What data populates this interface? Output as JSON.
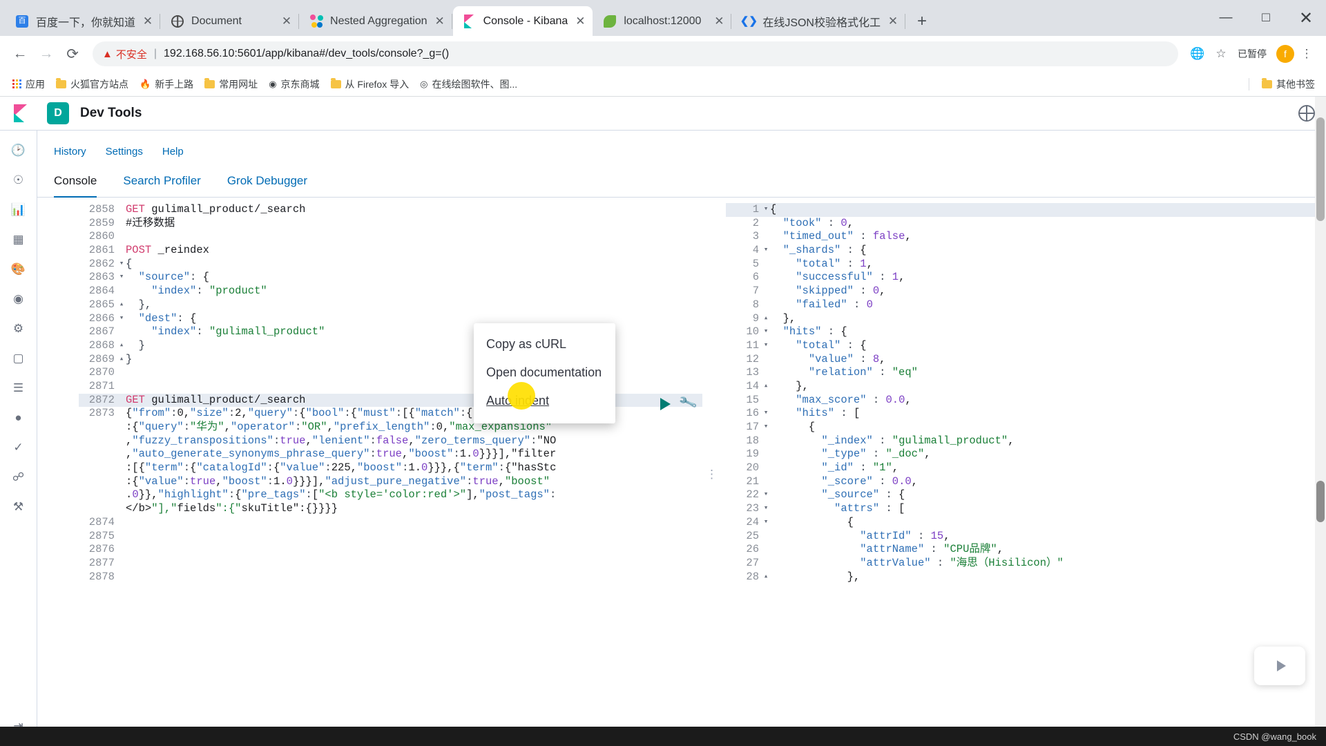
{
  "browser": {
    "tabs": [
      {
        "title": "百度一下，你就知道",
        "favicon": "baidu-icon",
        "active": false
      },
      {
        "title": "Document",
        "favicon": "globe-icon",
        "active": false
      },
      {
        "title": "Nested Aggregation",
        "favicon": "elasticsearch-icon",
        "active": false
      },
      {
        "title": "Console - Kibana",
        "favicon": "kibana-icon",
        "active": true
      },
      {
        "title": "localhost:12000",
        "favicon": "spring-leaf-icon",
        "active": false
      },
      {
        "title": "在线JSON校验格式化工",
        "favicon": "code-brackets-icon",
        "active": false
      }
    ],
    "new_tab_label": "+",
    "window_controls": {
      "minimize": "—",
      "maximize": "□",
      "close": "✕"
    },
    "nav": {
      "back": "←",
      "forward": "→",
      "reload": "⟳"
    },
    "omnibox": {
      "warning_icon": "warning-triangle-icon",
      "security_label": "不安全",
      "url_host": "192.168.56.10",
      "url_path": ":5601/app/kibana#/dev_tools/console?_g=()"
    },
    "toolbar_icons": {
      "translate": "translate-icon",
      "bookmark_star": "star-icon",
      "paused_label": "已暂停",
      "profile_initial": "f",
      "menu": "⋮"
    },
    "bookmarks": [
      {
        "label": "应用",
        "icon": "apps-grid-icon"
      },
      {
        "label": "火狐官方站点",
        "icon": "folder-icon"
      },
      {
        "label": "新手上路",
        "icon": "firefox-icon"
      },
      {
        "label": "常用网址",
        "icon": "folder-icon"
      },
      {
        "label": "京东商城",
        "icon": "jd-icon"
      },
      {
        "label": "从 Firefox 导入",
        "icon": "folder-icon"
      },
      {
        "label": "在线绘图软件、图...",
        "icon": "diagram-icon"
      }
    ],
    "bookmarks_right": {
      "label": "其他书签",
      "icon": "folder-icon"
    }
  },
  "kibana": {
    "app_title": "Dev Tools",
    "space_initial": "D",
    "logo": "kibana-logo-icon",
    "help_icon": "help-globe-icon",
    "topnav": [
      "History",
      "Settings",
      "Help"
    ],
    "tabs": [
      {
        "label": "Console",
        "active": true
      },
      {
        "label": "Search Profiler",
        "active": false
      },
      {
        "label": "Grok Debugger",
        "active": false
      }
    ],
    "sidebar_icons": [
      "recently-viewed-icon",
      "discover-icon",
      "visualize-icon",
      "dashboard-icon",
      "canvas-icon",
      "maps-icon",
      "machine-learning-icon",
      "infrastructure-icon",
      "logs-icon",
      "apm-icon",
      "uptime-icon",
      "siem-icon",
      "dev-tools-icon",
      "collapse-icon"
    ],
    "editor": {
      "run_icon": "play-triangle-icon",
      "wrench_icon": "wrench-icon",
      "lines": [
        {
          "n": "2858",
          "fold": "",
          "text": "GET gulimall_product/_search",
          "type": "request"
        },
        {
          "n": "2859",
          "fold": "",
          "text": "#迁移数据",
          "type": "comment"
        },
        {
          "n": "2860",
          "fold": "",
          "text": "",
          "type": "blank"
        },
        {
          "n": "2861",
          "fold": "",
          "text": "POST _reindex",
          "type": "request"
        },
        {
          "n": "2862",
          "fold": "▾",
          "text": "{",
          "type": "punc"
        },
        {
          "n": "2863",
          "fold": "▾",
          "text": "  \"source\": {",
          "type": "json"
        },
        {
          "n": "2864",
          "fold": "",
          "text": "    \"index\": \"product\"",
          "type": "json"
        },
        {
          "n": "2865",
          "fold": "▴",
          "text": "  },",
          "type": "punc"
        },
        {
          "n": "2866",
          "fold": "▾",
          "text": "  \"dest\": {",
          "type": "json"
        },
        {
          "n": "2867",
          "fold": "",
          "text": "    \"index\": \"gulimall_product\"",
          "type": "json"
        },
        {
          "n": "2868",
          "fold": "▴",
          "text": "  }",
          "type": "punc"
        },
        {
          "n": "2869",
          "fold": "▴",
          "text": "}",
          "type": "punc"
        },
        {
          "n": "2870",
          "fold": "",
          "text": "",
          "type": "blank"
        },
        {
          "n": "2871",
          "fold": "",
          "text": "",
          "type": "blank"
        },
        {
          "n": "2872",
          "fold": "",
          "text": "GET gulimall_product/_search",
          "type": "request-current"
        },
        {
          "n": "2873",
          "fold": "",
          "text": "{\"from\":0,\"size\":2,\"query\":{\"bool\":{\"must\":[{\"match\":{\"skuTitle\"",
          "type": "json-wrap"
        },
        {
          "n": "",
          "fold": "",
          "text": ":{\"query\":\"华为\",\"operator\":\"OR\",\"prefix_length\":0,\"max_expansions\"",
          "type": "json-wrap"
        },
        {
          "n": "",
          "fold": "",
          "text": ",\"fuzzy_transpositions\":true,\"lenient\":false,\"zero_terms_query\":\"NO",
          "type": "json-wrap"
        },
        {
          "n": "",
          "fold": "",
          "text": ",\"auto_generate_synonyms_phrase_query\":true,\"boost\":1.0}}}],\"filter",
          "type": "json-wrap"
        },
        {
          "n": "",
          "fold": "",
          "text": ":[{\"term\":{\"catalogId\":{\"value\":225,\"boost\":1.0}}},{\"term\":{\"hasStc",
          "type": "json-wrap"
        },
        {
          "n": "",
          "fold": "",
          "text": ":{\"value\":true,\"boost\":1.0}}}],\"adjust_pure_negative\":true,\"boost\"",
          "type": "json-wrap"
        },
        {
          "n": "",
          "fold": "",
          "text": ".0}},\"highlight\":{\"pre_tags\":[\"<b style='color:red'>\"],\"post_tags\":",
          "type": "json-wrap"
        },
        {
          "n": "",
          "fold": "",
          "text": "</b>\"],\"fields\":{\"skuTitle\":{}}}}",
          "type": "json-wrap"
        },
        {
          "n": "2874",
          "fold": "",
          "text": "",
          "type": "blank"
        },
        {
          "n": "2875",
          "fold": "",
          "text": "",
          "type": "blank"
        },
        {
          "n": "2876",
          "fold": "",
          "text": "",
          "type": "blank"
        },
        {
          "n": "2877",
          "fold": "",
          "text": "",
          "type": "blank"
        },
        {
          "n": "2878",
          "fold": "",
          "text": "",
          "type": "blank"
        }
      ]
    },
    "response": {
      "lines": [
        {
          "n": "1",
          "fold": "▾",
          "text": "{"
        },
        {
          "n": "2",
          "fold": "",
          "text": "  \"took\" : 0,"
        },
        {
          "n": "3",
          "fold": "",
          "text": "  \"timed_out\" : false,"
        },
        {
          "n": "4",
          "fold": "▾",
          "text": "  \"_shards\" : {"
        },
        {
          "n": "5",
          "fold": "",
          "text": "    \"total\" : 1,"
        },
        {
          "n": "6",
          "fold": "",
          "text": "    \"successful\" : 1,"
        },
        {
          "n": "7",
          "fold": "",
          "text": "    \"skipped\" : 0,"
        },
        {
          "n": "8",
          "fold": "",
          "text": "    \"failed\" : 0"
        },
        {
          "n": "9",
          "fold": "▴",
          "text": "  },"
        },
        {
          "n": "10",
          "fold": "▾",
          "text": "  \"hits\" : {"
        },
        {
          "n": "11",
          "fold": "▾",
          "text": "    \"total\" : {"
        },
        {
          "n": "12",
          "fold": "",
          "text": "      \"value\" : 8,"
        },
        {
          "n": "13",
          "fold": "",
          "text": "      \"relation\" : \"eq\""
        },
        {
          "n": "14",
          "fold": "▴",
          "text": "    },"
        },
        {
          "n": "15",
          "fold": "",
          "text": "    \"max_score\" : 0.0,"
        },
        {
          "n": "16",
          "fold": "▾",
          "text": "    \"hits\" : ["
        },
        {
          "n": "17",
          "fold": "▾",
          "text": "      {"
        },
        {
          "n": "18",
          "fold": "",
          "text": "        \"_index\" : \"gulimall_product\","
        },
        {
          "n": "19",
          "fold": "",
          "text": "        \"_type\" : \"_doc\","
        },
        {
          "n": "20",
          "fold": "",
          "text": "        \"_id\" : \"1\","
        },
        {
          "n": "21",
          "fold": "",
          "text": "        \"_score\" : 0.0,"
        },
        {
          "n": "22",
          "fold": "▾",
          "text": "        \"_source\" : {"
        },
        {
          "n": "23",
          "fold": "▾",
          "text": "          \"attrs\" : ["
        },
        {
          "n": "24",
          "fold": "▾",
          "text": "            {"
        },
        {
          "n": "25",
          "fold": "",
          "text": "              \"attrId\" : 15,"
        },
        {
          "n": "26",
          "fold": "",
          "text": "              \"attrName\" : \"CPU品牌\","
        },
        {
          "n": "27",
          "fold": "",
          "text": "              \"attrValue\" : \"海思（Hisilicon）\""
        },
        {
          "n": "28",
          "fold": "▴",
          "text": "            },"
        }
      ]
    },
    "context_menu": {
      "items": [
        {
          "label": "Copy as cURL",
          "link": false
        },
        {
          "label": "Open documentation",
          "link": false
        },
        {
          "label": "Auto indent",
          "link": true
        }
      ]
    }
  },
  "watermark": "CSDN @wang_book"
}
